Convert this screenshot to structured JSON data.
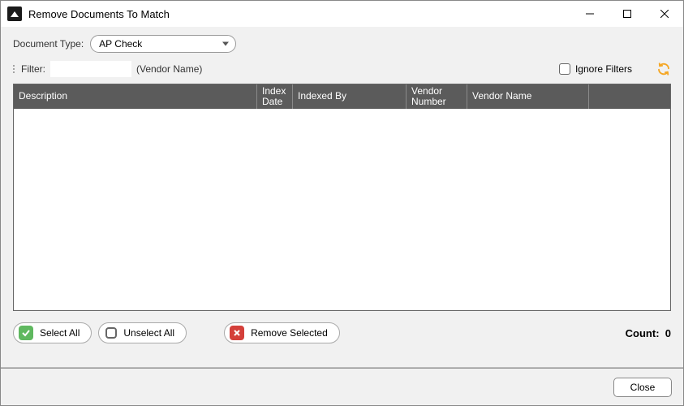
{
  "window": {
    "title": "Remove Documents To Match"
  },
  "toolbar": {
    "document_type_label": "Document Type:",
    "document_type_value": "AP Check"
  },
  "filter": {
    "label": "Filter:",
    "value": "",
    "hint": "(Vendor Name)",
    "ignore_filters_label": "Ignore Filters",
    "ignore_filters_checked": false
  },
  "table": {
    "columns": {
      "description": "Description",
      "index_date": "Index Date",
      "indexed_by": "Indexed By",
      "vendor_number": "Vendor Number",
      "vendor_name": "Vendor Name"
    },
    "rows": []
  },
  "actions": {
    "select_all": "Select All",
    "unselect_all": "Unselect All",
    "remove_selected": "Remove Selected"
  },
  "status": {
    "count_label": "Count:",
    "count_value": "0"
  },
  "footer": {
    "close": "Close"
  }
}
